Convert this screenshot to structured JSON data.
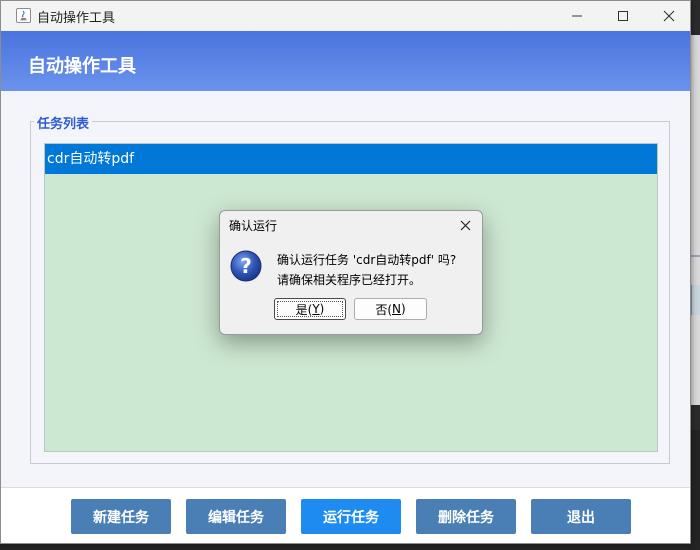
{
  "window": {
    "title": "自动操作工具",
    "header_title": "自动操作工具"
  },
  "task_panel": {
    "group_title": "任务列表",
    "tasks": [
      {
        "label": "cdr自动转pdf",
        "selected": true
      }
    ]
  },
  "footer": {
    "buttons": [
      {
        "label": "新建任务"
      },
      {
        "label": "编辑任务"
      },
      {
        "label": "运行任务"
      },
      {
        "label": "删除任务"
      },
      {
        "label": "退出"
      }
    ]
  },
  "dialog": {
    "title": "确认运行",
    "message_line1": "确认运行任务 'cdr自动转pdf' 吗?",
    "message_line2": "请确保相关程序已经打开。",
    "yes_label": "是(",
    "yes_mnemonic": "Y",
    "yes_suffix": ")",
    "no_label": "否(",
    "no_mnemonic": "N",
    "no_suffix": ")",
    "icon": "question-icon"
  },
  "colors": {
    "header": "#4a73de",
    "selection": "#0078d7",
    "list_bg": "#cde8d2",
    "button": "#4a7fb5",
    "button_active": "#1e8bf0",
    "group_title": "#2f5cd0"
  }
}
